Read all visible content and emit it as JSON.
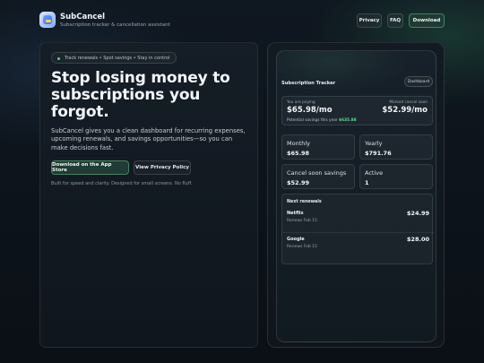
{
  "header": {
    "app_name": "SubCancel",
    "tagline": "Subscription tracker & cancellation assistant",
    "nav": {
      "privacy": "Privacy",
      "faq": "FAQ",
      "download": "Download"
    }
  },
  "hero": {
    "pill": "Track renewals • Spot savings • Stay in control",
    "title": "Stop losing money to subscriptions you forgot.",
    "description": "SubCancel gives you a clean dashboard for recurring expenses, upcoming renewals, and savings opportunities—so you can make decisions fast.",
    "primary_button": "Download on the App Store",
    "secondary_button": "View Privacy Policy",
    "fine_print": "Built for speed and clarity. Designed for small screens. No fluff."
  },
  "phone": {
    "title": "Subscription Tracker",
    "dashboard_label": "Dashboard",
    "summary": {
      "paying_label": "You are paying",
      "paying_value": "$65.98/mo",
      "cancel_label": "Marked cancel soon",
      "cancel_value": "$52.99/mo",
      "savings_label": "Potential savings this year",
      "savings_value": "$635.88"
    },
    "stats": [
      {
        "label": "Monthly",
        "value": "$65.98"
      },
      {
        "label": "Yearly",
        "value": "$791.76"
      },
      {
        "label": "Cancel soon savings",
        "value": "$52.99"
      },
      {
        "label": "Active",
        "value": "1"
      }
    ],
    "renewals": {
      "heading": "Next renewals",
      "items": [
        {
          "name": "Netflix",
          "date": "Renews Feb 15",
          "price": "$24.99"
        },
        {
          "name": "Google",
          "date": "Renews Feb 15",
          "price": "$28.00"
        }
      ]
    }
  },
  "colors": {
    "accent": "#55d389",
    "background": "#0f1720",
    "button_primary": "#1f3b34"
  }
}
